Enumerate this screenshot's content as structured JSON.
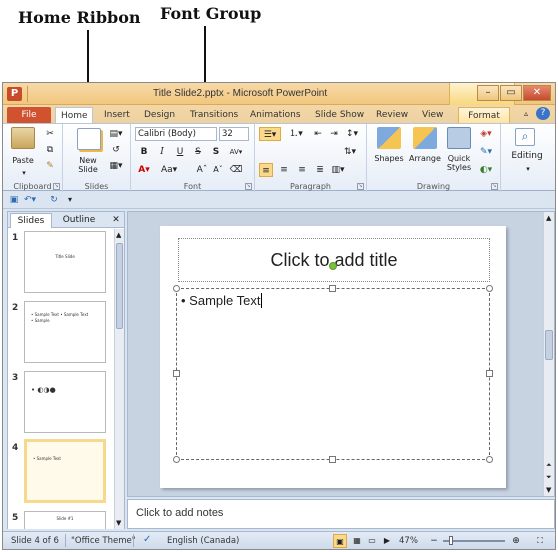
{
  "callouts": {
    "home_ribbon": "Home Ribbon",
    "font_group": "Font Group"
  },
  "window": {
    "title": "Title Slide2.pptx - Microsoft PowerPoint",
    "app_icon": "P",
    "controls": [
      "–",
      "▭",
      "✕"
    ]
  },
  "tabs": [
    "File",
    "Home",
    "Insert",
    "Design",
    "Transitions",
    "Animations",
    "Slide Show",
    "Review",
    "View",
    "Format"
  ],
  "ribbon": {
    "clipboard": {
      "label": "Clipboard",
      "paste": "Paste"
    },
    "slides": {
      "label": "Slides",
      "new_slide": "New Slide"
    },
    "font": {
      "label": "Font",
      "font_name": "Calibri (Body)",
      "font_size": "32"
    },
    "paragraph": {
      "label": "Paragraph"
    },
    "drawing": {
      "label": "Drawing",
      "shapes": "Shapes",
      "arrange": "Arrange",
      "quick_styles": "Quick Styles"
    },
    "editing": {
      "label": "Editing"
    }
  },
  "panel": {
    "tabs": [
      "Slides",
      "Outline"
    ],
    "close": "✕",
    "thumbs": [
      {
        "num": "1",
        "text": "Title Slide"
      },
      {
        "num": "2",
        "text": "• Sample Text • Sample Text • Sample"
      },
      {
        "num": "3",
        "text": "• ◐◑●"
      },
      {
        "num": "4",
        "text": "• Sample Text"
      },
      {
        "num": "5",
        "text": "Slide #1"
      }
    ]
  },
  "slide": {
    "title": "Click to add title",
    "body": "Sample Text"
  },
  "notes": "Click to add notes",
  "status": {
    "slide_info": "Slide 4 of 6",
    "theme": "\"Office Theme\"",
    "language": "English (Canada)",
    "zoom": "47%"
  }
}
